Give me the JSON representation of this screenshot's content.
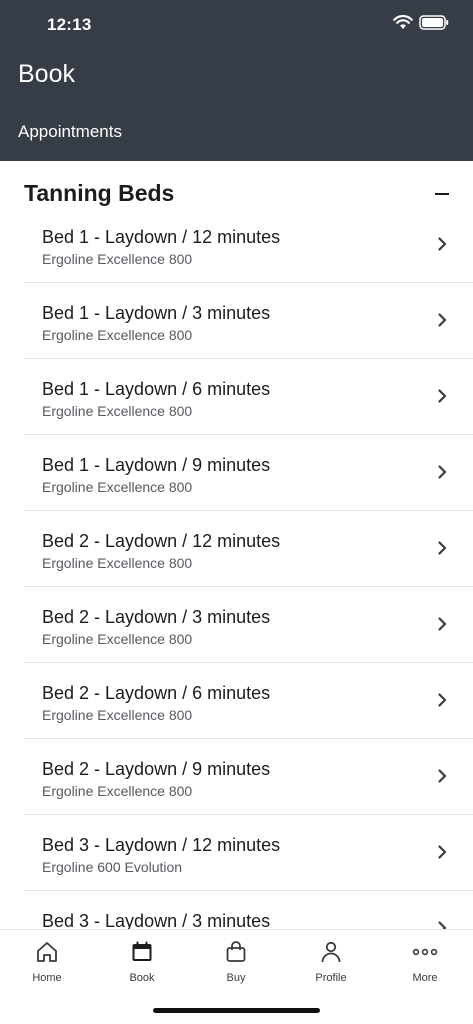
{
  "status": {
    "time": "12:13"
  },
  "header": {
    "title": "Book",
    "subnav": "Appointments"
  },
  "section": {
    "title": "Tanning Beds"
  },
  "items": [
    {
      "title": "Bed 1 - Laydown / 12 minutes",
      "subtitle": "Ergoline Excellence 800"
    },
    {
      "title": "Bed 1 - Laydown / 3 minutes",
      "subtitle": "Ergoline Excellence 800"
    },
    {
      "title": "Bed 1 - Laydown / 6 minutes",
      "subtitle": "Ergoline Excellence 800"
    },
    {
      "title": "Bed 1 - Laydown / 9 minutes",
      "subtitle": "Ergoline Excellence 800"
    },
    {
      "title": "Bed 2 - Laydown / 12 minutes",
      "subtitle": "Ergoline Excellence 800"
    },
    {
      "title": "Bed 2 - Laydown / 3 minutes",
      "subtitle": "Ergoline Excellence 800"
    },
    {
      "title": "Bed 2 - Laydown / 6 minutes",
      "subtitle": "Ergoline Excellence 800"
    },
    {
      "title": "Bed 2 - Laydown / 9 minutes",
      "subtitle": "Ergoline Excellence 800"
    },
    {
      "title": "Bed 3 - Laydown / 12 minutes",
      "subtitle": "Ergoline 600 Evolution"
    },
    {
      "title": "Bed 3 - Laydown / 3 minutes",
      "subtitle": ""
    }
  ],
  "tabs": [
    {
      "label": "Home",
      "icon": "home-icon"
    },
    {
      "label": "Book",
      "icon": "calendar-icon"
    },
    {
      "label": "Buy",
      "icon": "shopping-bag-icon"
    },
    {
      "label": "Profile",
      "icon": "person-icon"
    },
    {
      "label": "More",
      "icon": "more-dots-icon"
    }
  ],
  "colors": {
    "header_bg": "#363d47",
    "text": "#1c1c1e",
    "subtitle": "#555a60"
  }
}
